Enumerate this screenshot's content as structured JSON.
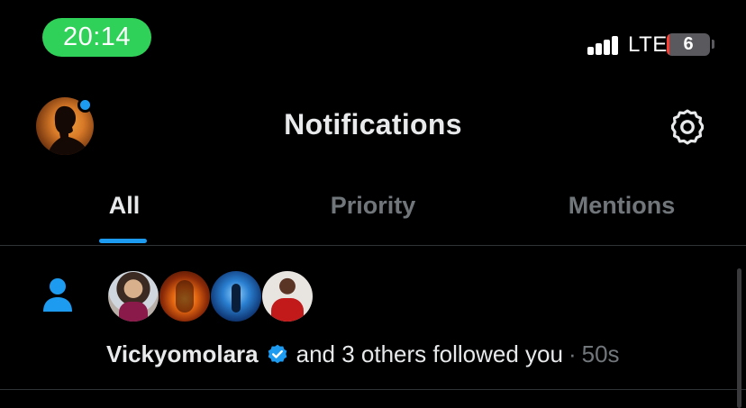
{
  "status_bar": {
    "time": "20:14",
    "network": "LTE",
    "battery_level": "6",
    "battery_fraction": 0.06,
    "colors": {
      "time_pill": "#30d158",
      "battery_low": "#ff3b30"
    }
  },
  "header": {
    "title": "Notifications",
    "icons": {
      "avatar": "profile-avatar",
      "settings": "gear-icon",
      "unread_dot": "unread-dot"
    }
  },
  "tabs": [
    {
      "label": "All",
      "active": true
    },
    {
      "label": "Priority",
      "active": false
    },
    {
      "label": "Mentions",
      "active": false
    }
  ],
  "notifications": [
    {
      "type_icon": "person-icon",
      "user": "Vickyomolara",
      "verified": true,
      "message": "and 3 others followed you",
      "separator": "·",
      "time": "50s"
    }
  ],
  "colors": {
    "accent": "#1d9bf0",
    "background": "#000000",
    "muted_text": "#71767b",
    "divider": "#2f3336"
  }
}
